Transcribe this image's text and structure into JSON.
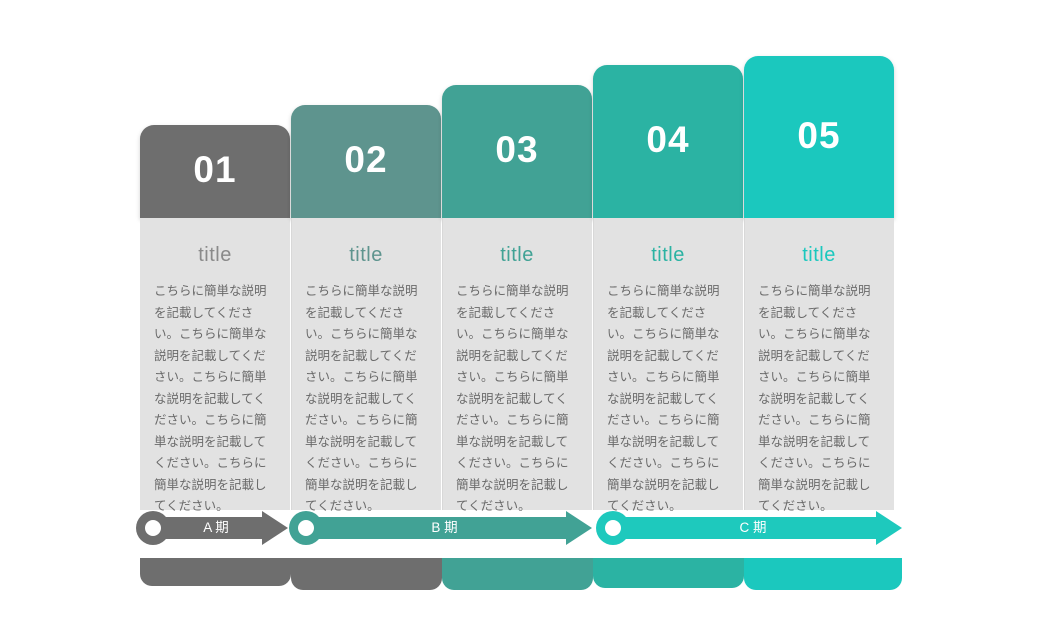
{
  "diagram": {
    "type": "staircase-step-infographic",
    "body_text": "こちらに簡単な説明を記載してください。こちらに簡単な説明を記載してください。こちらに簡単な説明を記載してください。こちらに簡単な説明を記載してください。こちらに簡単な説明を記載してください。",
    "cards": [
      {
        "number": "01",
        "title": "title",
        "color": "#6e6e6e",
        "text": "こちらに簡単な説明を記載してください。こちらに簡単な説明を記載してください。こちらに簡単な説明を記載してください。こちらに簡単な説明を記載してください。こちらに簡単な説明を記載してください。"
      },
      {
        "number": "02",
        "title": "title",
        "color": "#5e948e",
        "text": "こちらに簡単な説明を記載してください。こちらに簡単な説明を記載してください。こちらに簡単な説明を記載してください。こちらに簡単な説明を記載してください。こちらに簡単な説明を記載してください。"
      },
      {
        "number": "03",
        "title": "title",
        "color": "#41a295",
        "text": "こちらに簡単な説明を記載してください。こちらに簡単な説明を記載してください。こちらに簡単な説明を記載してください。こちらに簡単な説明を記載してください。こちらに簡単な説明を記載してください。"
      },
      {
        "number": "04",
        "title": "title",
        "color": "#2bb3a3",
        "text": "こちらに簡単な説明を記載してください。こちらに簡単な説明を記載してください。こちらに簡単な説明を記載してください。こちらに簡単な説明を記載してください。こちらに簡単な説明を記載してください。"
      },
      {
        "number": "05",
        "title": "title",
        "color": "#1bc8be",
        "text": "こちらに簡単な説明を記載してください。こちらに簡単な説明を記載してください。こちらに簡単な説明を記載してください。こちらに簡単な説明を記載してください。こちらに簡単な説明を記載してください。"
      }
    ],
    "timeline": [
      {
        "label": "A 期",
        "color": "#6e6e6e"
      },
      {
        "label": "B 期",
        "color": "#41a295"
      },
      {
        "label": "C 期",
        "color": "#1ec9bd"
      }
    ],
    "footer_segments": [
      {
        "color": "#6e6e6e"
      },
      {
        "color": "#6e6e6e"
      },
      {
        "color": "#41a295"
      },
      {
        "color": "#2bb3a3"
      },
      {
        "color": "#1bc8be"
      }
    ]
  }
}
